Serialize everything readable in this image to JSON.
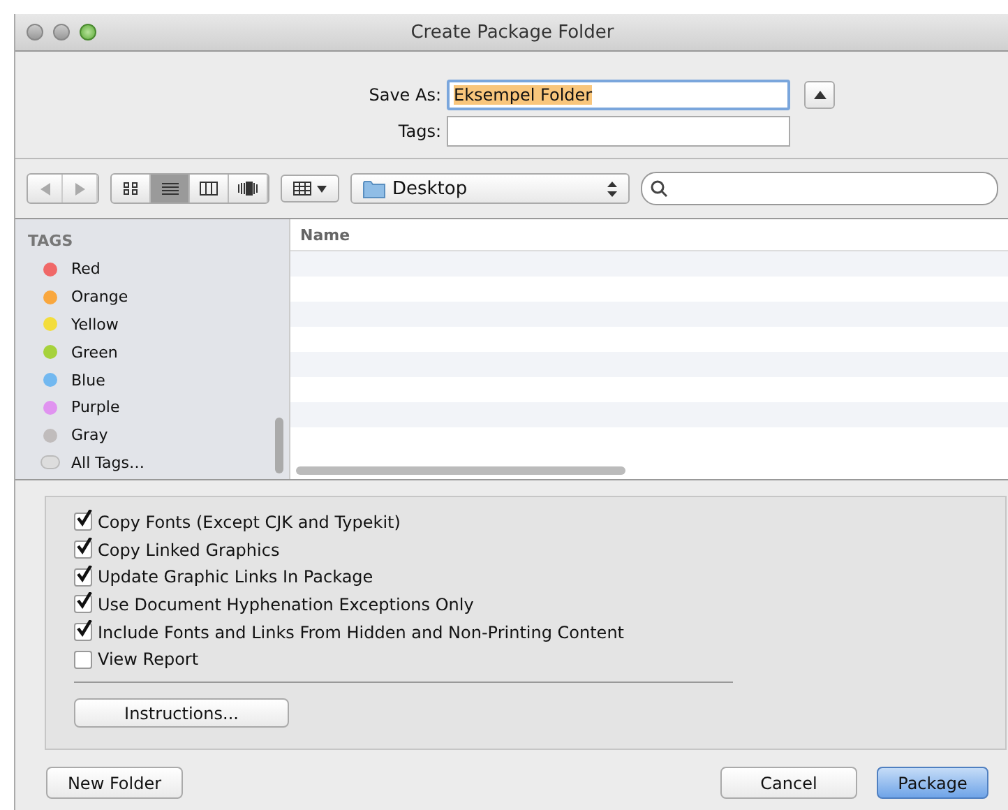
{
  "window": {
    "title": "Create Package Folder"
  },
  "save_as": {
    "label": "Save As:",
    "value": "Eksempel Folder"
  },
  "tags_field": {
    "label": "Tags:"
  },
  "view_modes": [
    {
      "kind": "icons",
      "selected": false
    },
    {
      "kind": "list",
      "selected": true
    },
    {
      "kind": "columns",
      "selected": false
    },
    {
      "kind": "coverflow",
      "selected": false
    }
  ],
  "location": {
    "label": "Desktop"
  },
  "sidebar": {
    "heading": "TAGS",
    "items": [
      {
        "label": "Red",
        "color": "#f06868"
      },
      {
        "label": "Orange",
        "color": "#f9a73e"
      },
      {
        "label": "Yellow",
        "color": "#f3dd3c"
      },
      {
        "label": "Green",
        "color": "#a6d23c"
      },
      {
        "label": "Blue",
        "color": "#72b8f0"
      },
      {
        "label": "Purple",
        "color": "#e093f0"
      },
      {
        "label": "Gray",
        "color": "#c0bcbc"
      },
      {
        "label": "All Tags…"
      }
    ]
  },
  "file_list": {
    "columns": [
      "Name"
    ]
  },
  "options": [
    {
      "label": "Copy Fonts (Except CJK and Typekit)",
      "checked": true
    },
    {
      "label": "Copy Linked Graphics",
      "checked": true
    },
    {
      "label": "Update Graphic Links In Package",
      "checked": true
    },
    {
      "label": "Use Document Hyphenation Exceptions Only",
      "checked": true
    },
    {
      "label": "Include Fonts and Links From Hidden and Non-Printing Content",
      "checked": true
    },
    {
      "label": "View Report",
      "checked": false
    }
  ],
  "instructions_button": "Instructions...",
  "buttons": {
    "new_folder": "New Folder",
    "cancel": "Cancel",
    "package": "Package"
  }
}
